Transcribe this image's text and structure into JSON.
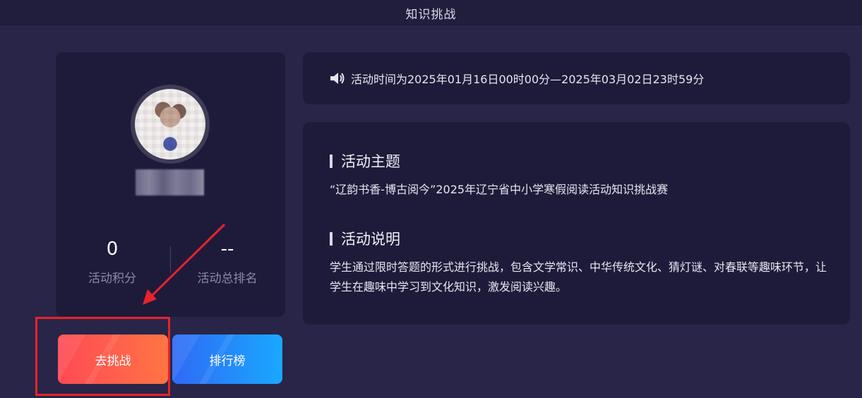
{
  "header": {
    "title": "知识挑战"
  },
  "profile": {
    "points_value": "0",
    "points_label": "活动积分",
    "rank_value": "--",
    "rank_label": "活动总排名"
  },
  "buttons": {
    "challenge_label": "去挑战",
    "ranking_label": "排行榜"
  },
  "activity_time": {
    "icon": "speaker-icon",
    "text": "活动时间为2025年01月16日00时00分—2025年03月02日23时59分"
  },
  "info": {
    "theme_heading": "活动主题",
    "theme_text": "“辽韵书香-博古阅今”2025年辽宁省中小学寒假阅读活动知识挑战赛",
    "desc_heading": "活动说明",
    "desc_text": "学生通过限时答题的形式进行挑战，包含文学常识、中华传统文化、猜灯谜、对春联等趣味环节，让学生在趣味中学习到文化知识，激发阅读兴趣。"
  },
  "colors": {
    "background": "#282548",
    "card": "#1e1b3a",
    "challenge_button": "#ff5a4e",
    "ranking_button": "#2a86fb",
    "annotation": "#e8232a"
  }
}
